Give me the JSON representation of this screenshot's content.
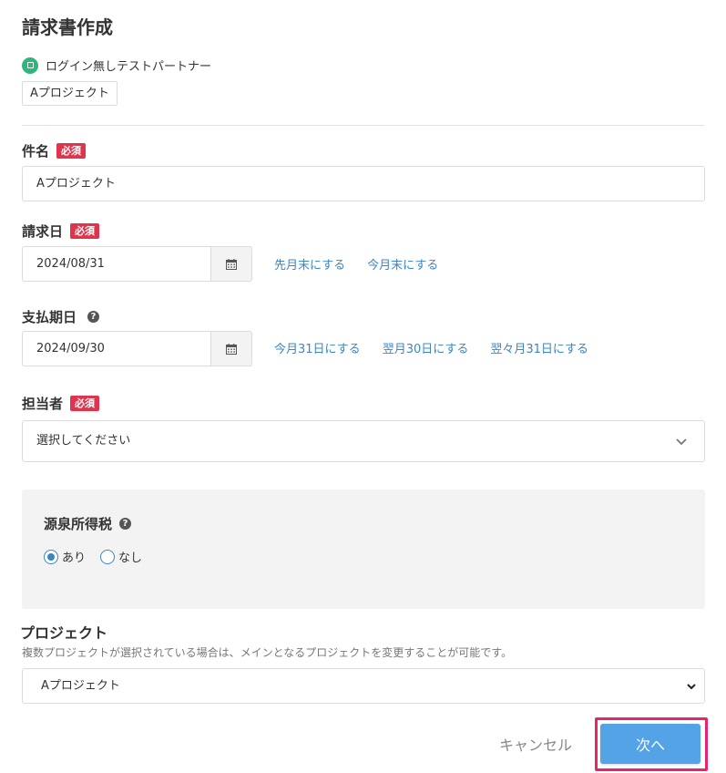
{
  "page": {
    "title": "請求書作成"
  },
  "partner": {
    "name": "ログイン無しテストパートナー",
    "project_tag": "Aプロジェクト"
  },
  "subject": {
    "label": "件名",
    "required": "必須",
    "value": "Aプロジェクト"
  },
  "invoice_date": {
    "label": "請求日",
    "required": "必須",
    "value": "2024/08/31",
    "links": [
      "先月末にする",
      "今月末にする"
    ]
  },
  "due_date": {
    "label": "支払期日",
    "help": "?",
    "value": "2024/09/30",
    "links": [
      "今月31日にする",
      "翌月30日にする",
      "翌々月31日にする"
    ]
  },
  "assignee": {
    "label": "担当者",
    "required": "必須",
    "placeholder": "選択してください"
  },
  "withholding": {
    "label": "源泉所得税",
    "help": "?",
    "options": [
      {
        "label": "あり",
        "checked": true
      },
      {
        "label": "なし",
        "checked": false
      }
    ]
  },
  "project": {
    "label": "プロジェクト",
    "help_text": "複数プロジェクトが選択されている場合は、メインとなるプロジェクトを変更することが可能です。",
    "selected": "Aプロジェクト"
  },
  "actions": {
    "cancel": "キャンセル",
    "next": "次へ"
  },
  "colors": {
    "accent": "#53a3e6",
    "link": "#3b86c6",
    "required": "#e0334c",
    "highlight": "#e8246a",
    "partner_icon": "#2fb67c"
  }
}
